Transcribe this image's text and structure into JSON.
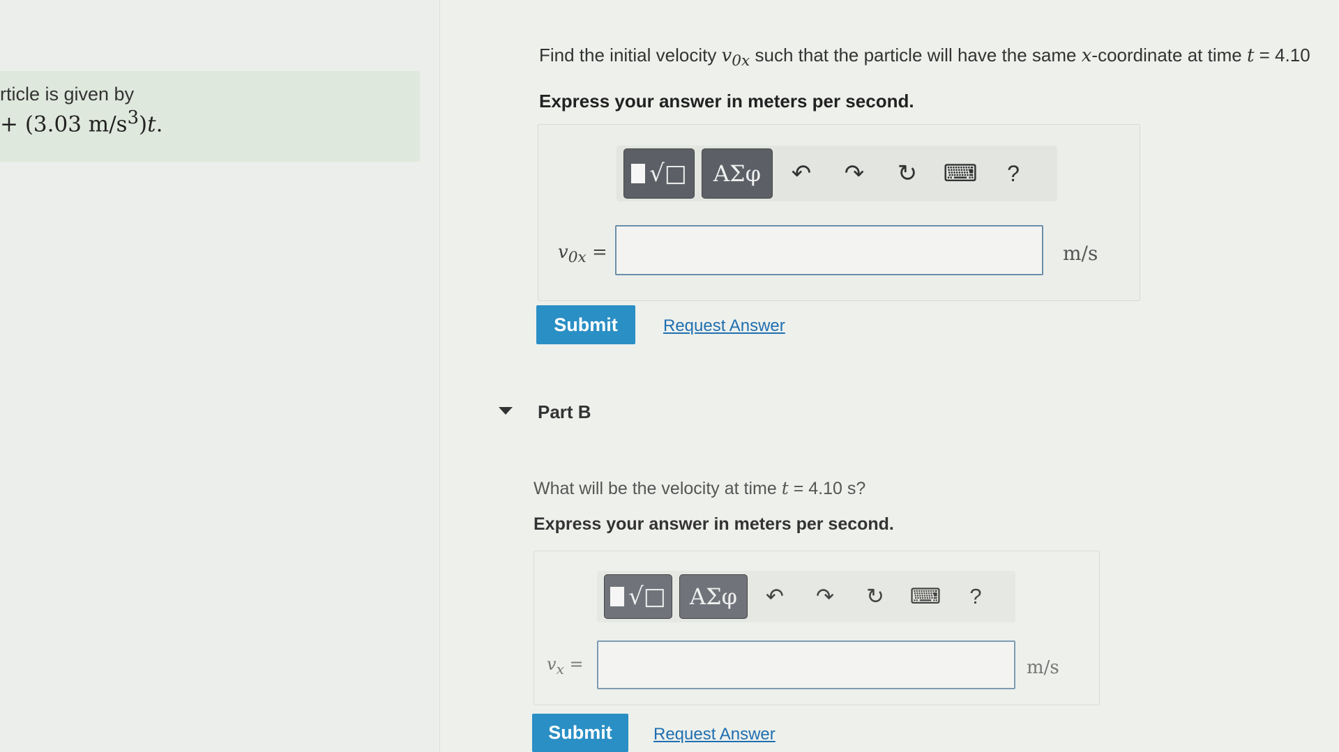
{
  "intro": {
    "line1": "rticle is given by",
    "line2_prefix": "+ (3.03 m/s",
    "line2_exp": "3",
    "line2_suffix": ")",
    "line2_var": "t",
    "line2_end": "."
  },
  "part_a": {
    "question_text": "Find the initial velocity ",
    "question_var": "v",
    "question_sub": "0x",
    "question_mid": " such that the particle will have the same ",
    "question_x": "x",
    "question_rest": "-coordinate at time ",
    "question_t": "t",
    "question_value": " = 4.10",
    "express": "Express your answer in meters per second.",
    "variable_label": "v",
    "variable_sub": "0x",
    "variable_eq": " =",
    "input_value": "",
    "unit": "m/s",
    "submit_label": "Submit",
    "request_label": "Request Answer"
  },
  "part_b": {
    "title": "Part B",
    "question_text": "What will be the velocity at time ",
    "question_t": "t",
    "question_value": " = 4.10 s?",
    "express": "Express your answer in meters per second.",
    "variable_label": "v",
    "variable_sub": "x",
    "variable_eq": " =",
    "input_value": "",
    "unit": "m/s",
    "submit_label": "Submit",
    "request_label": "Request Answer"
  },
  "toolbar": {
    "greek_label": "ΑΣφ",
    "help_label": "?",
    "icons": [
      "templates-icon",
      "greek-icon",
      "undo-icon",
      "redo-icon",
      "reset-icon",
      "keyboard-icon",
      "help-icon"
    ]
  },
  "colors": {
    "accent": "#2a8fc4",
    "link": "#1f6fb0",
    "toolbar_button": "#5c6066"
  }
}
